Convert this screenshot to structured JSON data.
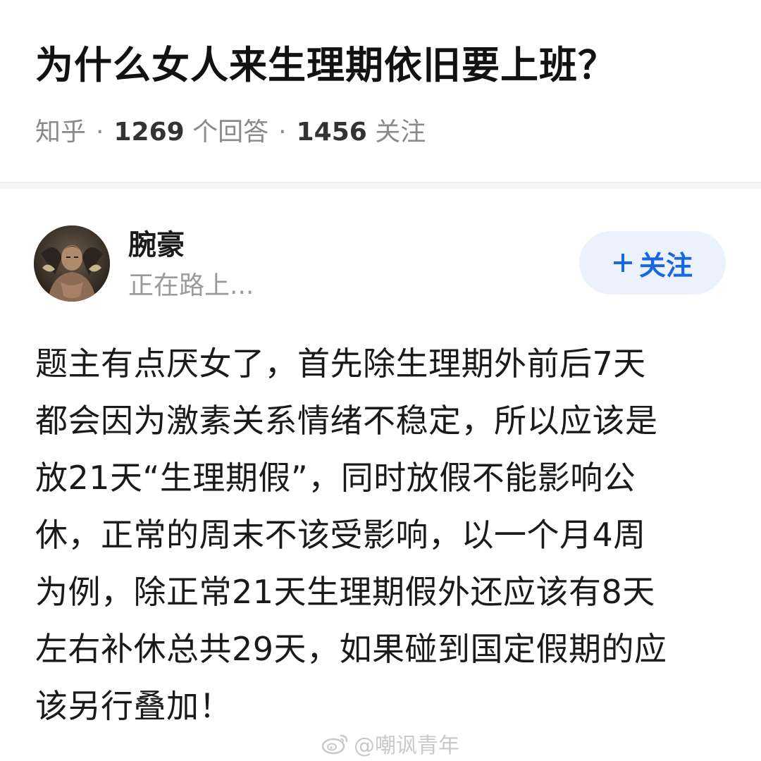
{
  "question": {
    "title": "为什么女人来生理期依旧要上班？",
    "source": "知乎",
    "answer_count": "1269",
    "answer_label": "个回答",
    "follow_count": "1456",
    "follow_label": "关注",
    "separator": "·"
  },
  "author": {
    "name": "腕豪",
    "bio": "正在路上...",
    "avatar_icon": "avatar-portrait",
    "follow_button": {
      "icon": "plus-icon",
      "label": "关注"
    }
  },
  "answer": {
    "lines": [
      "题主有点厌女了，首先除生理期外前后7天",
      "都会因为激素关系情绪不稳定，所以应该是",
      "放21天“生理期假”，同时放假不能影响公",
      "休，正常的周末不该受影响，以一个月4周",
      "为例，除正常21天生理期假外还应该有8天",
      "左右补休总共29天，如果碰到国定假期的应",
      "该另行叠加！"
    ]
  },
  "watermark": {
    "icon": "weibo-icon",
    "text": "@嘲讽青年"
  },
  "colors": {
    "accent": "#1767e4",
    "follow_bg": "#ebf2fd",
    "meta_gray": "#8a8a8a",
    "text": "#1a1a1a"
  }
}
